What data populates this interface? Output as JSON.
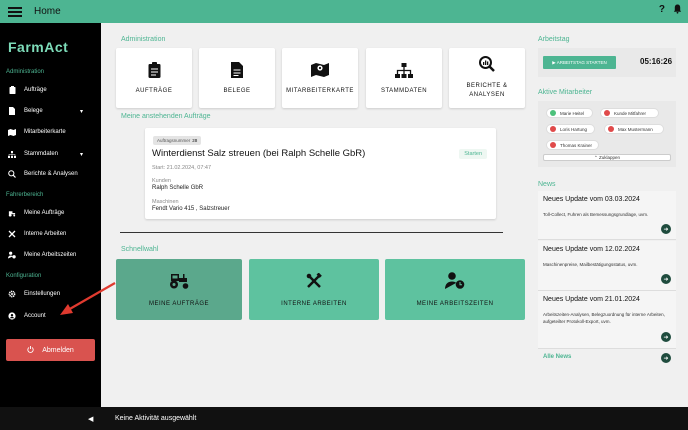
{
  "header": {
    "title": "Home",
    "help": "?",
    "bell": "bell-icon"
  },
  "sidebar": {
    "logo": "FarmAct",
    "sections": {
      "admin": "Administration",
      "personal": "Fahrerbereich",
      "config": "Konfiguration"
    },
    "items": [
      {
        "label": "Aufträge",
        "icon": "clipboard-icon"
      },
      {
        "label": "Belege",
        "icon": "file-icon",
        "caret": "▾"
      },
      {
        "label": "Mitarbeiterkarte",
        "icon": "map-icon"
      },
      {
        "label": "Stammdaten",
        "icon": "sitemap-icon",
        "caret": "▾"
      },
      {
        "label": "Berichte & Analysen",
        "icon": "search-chart-icon"
      },
      {
        "label": "Meine Aufträge",
        "icon": "tractor-icon"
      },
      {
        "label": "Interne Arbeiten",
        "icon": "tools-icon"
      },
      {
        "label": "Meine Arbeitszeiten",
        "icon": "user-clock-icon"
      },
      {
        "label": "Einstellungen",
        "icon": "gear-icon"
      },
      {
        "label": "Account",
        "icon": "user-circle-icon"
      }
    ],
    "logout": "Abmelden"
  },
  "main": {
    "admin_heading": "Administration",
    "tiles": [
      {
        "label": "AUFTRÄGE",
        "icon": "clipboard-icon"
      },
      {
        "label": "BELEGE",
        "icon": "file-icon"
      },
      {
        "label": "MITARBEITERKARTE",
        "icon": "map-icon"
      },
      {
        "label": "STAMMDATEN",
        "icon": "sitemap-icon"
      },
      {
        "label": "BERICHTE & ANALYSEN",
        "icon": "search-chart-icon"
      }
    ],
    "tasks_heading": "Meine anstehenden Aufträge",
    "task": {
      "badge_label": "Auftragsnummer",
      "badge_number": "28",
      "title": "Winterdienst Salz streuen (bei Ralph Schelle GbR)",
      "start_label": "Starten",
      "start_time": "Start: 21.02.2024, 07:47",
      "customer_label": "Kunden",
      "customer": "Ralph Schelle GbR",
      "machines_label": "Maschinen",
      "machines": "Fendt Vario 415 , Salzstreuer"
    },
    "quick_heading": "Schnellwahl",
    "quick": [
      {
        "label": "MEINE AUFTRÄGE",
        "icon": "tractor-icon",
        "color": "#5ba88c"
      },
      {
        "label": "INTERNE ARBEITEN",
        "icon": "tools-icon",
        "color": "#5ec29f"
      },
      {
        "label": "MEINE ARBEITSZEITEN",
        "icon": "user-clock-icon",
        "color": "#5ec29f"
      }
    ]
  },
  "right": {
    "workday_heading": "Arbeitstag",
    "start_button": "▶ ARBEITSTAG STARTEN",
    "timer": "05:16:26",
    "active_heading": "Aktive Mitarbeiter",
    "employees": [
      {
        "name": "Marie Heitel",
        "color": "#4cc17b"
      },
      {
        "name": "Kunde Mitfahrer",
        "color": "#e04a4a"
      },
      {
        "name": "Loris Hartung",
        "color": "#e04a4a"
      },
      {
        "name": "Max Mustermann",
        "color": "#e04a4a"
      },
      {
        "name": "Thomas Krainer",
        "color": "#e04a4a"
      }
    ],
    "collapse": "⌃ Zuklappen",
    "news_heading": "News",
    "news": [
      {
        "title": "Neues Update vom 03.03.2024",
        "desc": "Toll-Collect, Fuhren als Bemessungsgrundlage, uvm."
      },
      {
        "title": "Neues Update vom 12.02.2024",
        "desc": "Maschinenpreise, Mailbestätigungsstatus, uvm."
      },
      {
        "title": "Neues Update vom 21.01.2024",
        "desc": "Arbeitszeiten-Analysen, Belegzuordnung für interne Arbeiten, aufgeteilter Protokoll-Export, uvm."
      }
    ],
    "all_news": "Alle News"
  },
  "footer": {
    "collapse": "◀",
    "status": "Keine Aktivität ausgewählt"
  },
  "colors": {
    "accent": "#4db592",
    "danger": "#d9534f",
    "annotation_arrow": "#e03a2f"
  }
}
